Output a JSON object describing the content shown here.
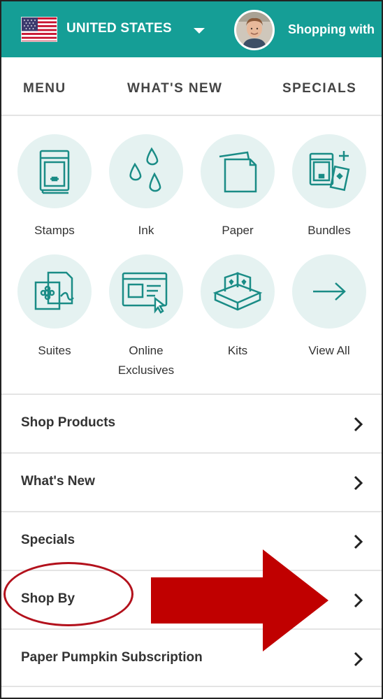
{
  "header": {
    "country": "UNITED STATES",
    "shopping_text": "Shopping with",
    "flag_icon": "us-flag-icon",
    "dropdown_icon": "caret-down-icon",
    "avatar_icon": "demonstrator-avatar",
    "background_color": "#159e96"
  },
  "nav": {
    "items": [
      {
        "label": "MENU"
      },
      {
        "label": "WHAT'S NEW"
      },
      {
        "label": "SPECIALS"
      }
    ]
  },
  "categories": [
    {
      "label": "Stamps",
      "icon": "stamps-icon"
    },
    {
      "label": "Ink",
      "icon": "ink-drops-icon"
    },
    {
      "label": "Paper",
      "icon": "paper-sheets-icon"
    },
    {
      "label": "Bundles",
      "icon": "bundles-icon"
    },
    {
      "label": "Suites",
      "icon": "suites-icon"
    },
    {
      "label": "Online Exclusives",
      "line1": "Online",
      "line2": "Exclusives",
      "icon": "online-exclusives-icon"
    },
    {
      "label": "Kits",
      "icon": "kits-box-icon"
    },
    {
      "label": "View All",
      "icon": "arrow-right-icon"
    }
  ],
  "menu_list": [
    {
      "label": "Shop Products"
    },
    {
      "label": "What's New"
    },
    {
      "label": "Specials"
    },
    {
      "label": "Shop By"
    },
    {
      "label": "Paper Pumpkin Subscription"
    }
  ],
  "annotations": {
    "highlight_color": "#b3111c",
    "arrow_color": "#c00000"
  },
  "colors": {
    "accent": "#159e96",
    "icon_stroke": "#1a8c86",
    "icon_background": "#e5f2f1"
  }
}
